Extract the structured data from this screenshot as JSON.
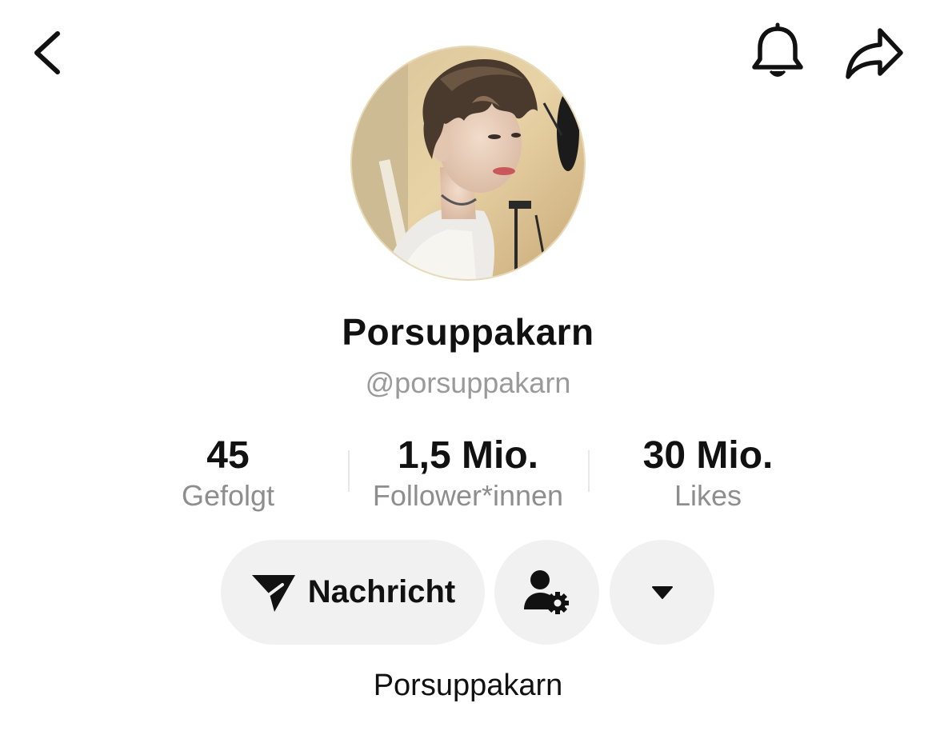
{
  "header": {
    "back_icon": "chevron-left-icon",
    "bell_icon": "bell-icon",
    "share_icon": "share-arrow-icon"
  },
  "profile": {
    "display_name": "Porsuppakarn",
    "handle": "@porsuppakarn",
    "bio": "Porsuppakarn"
  },
  "stats": {
    "following": {
      "value": "45",
      "label": "Gefolgt"
    },
    "followers": {
      "value": "1,5 Mio.",
      "label": "Follower*innen"
    },
    "likes": {
      "value": "30 Mio.",
      "label": "Likes"
    }
  },
  "actions": {
    "message_label": "Nachricht",
    "message_icon": "paper-plane-icon",
    "profile_settings_icon": "person-gear-icon",
    "more_icon": "caret-down-icon"
  },
  "colors": {
    "text_primary": "#111111",
    "text_secondary": "#8e8e8e",
    "button_bg": "#f1f1f1"
  }
}
